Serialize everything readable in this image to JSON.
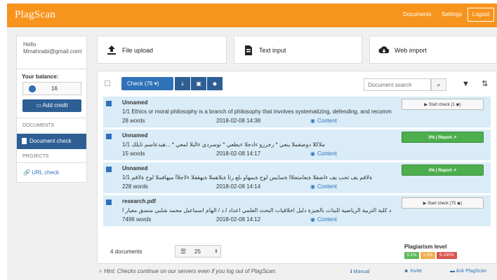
{
  "app": {
    "logo": "PlagScan"
  },
  "topnav": {
    "documents": "Documents",
    "settings": "Settings",
    "logout": "Logout"
  },
  "sidebar": {
    "greeting": "Hello Mmahnabi@gmail.com!",
    "balance_label": "Your balance:",
    "balance_value": "16",
    "add_credit": "Add credit",
    "section_documents": "DOCUMENTS",
    "document_check": "Document check",
    "section_projects": "PROJECTS",
    "url_check": "URL check"
  },
  "upload_options": [
    {
      "label": "File upload",
      "icon": "upload-icon"
    },
    {
      "label": "Text input",
      "icon": "text-input-icon"
    },
    {
      "label": "Web import",
      "icon": "cloud-download-icon"
    }
  ],
  "toolbar": {
    "check_label": "Check (76 ▾)",
    "search_placeholder": "Document search"
  },
  "documents": [
    {
      "title": "Unnamed",
      "preview": "1/1 Ethics or moral philosophy is a branch of philosophy that involves systematizing, defending, and recommen",
      "words": "28 words",
      "date": "2018-02-08 14:38",
      "content": "Content",
      "action": "▶ Start check (1 ◉)",
      "action_type": "start"
    },
    {
      "title": "Unnamed",
      "preview": "1/1 ملاكلا دوصقملا ينعي * رجرزو ءادجلا ءيطعي * نوسردي ءالبلا لمعي * ...هيدعاسم تايلك",
      "words": "15 words",
      "date": "2018-02-08 14:17",
      "content": "Content",
      "action": "0% | Report ↗",
      "action_type": "report"
    },
    {
      "title": "Unnamed",
      "preview": "1/1 ةلاقم يف ثحب يف ءاضقلا ةيعامتجلاا ةسايس لوح ةيمهأو ىلع رثأ ةيلاهملا ةيهقفلا ءلاجلأا ميهافملا لوح ةلاقم",
      "words": "228 words",
      "date": "2018-02-08 14:14",
      "content": "Content",
      "action": "0% | Report ↗",
      "action_type": "report"
    },
    {
      "title": "research.pdf",
      "preview": "ع التطوير المستمر والتأهيل لاعتماد كلية التربية الرياضية للبنات بالجيزة دليل اخلاقيات البحث العلمي اعداد ا.د / الهام اسماعيل محمد شلبي منسق معيار ا",
      "words": "7496 words",
      "date": "2018-02-08 14:12",
      "content": "Content",
      "action": "▶ Start check (75 ◉)",
      "action_type": "start"
    }
  ],
  "footer_bar": {
    "doc_count": "4 documents",
    "page_size": "25"
  },
  "plagiarism_level": {
    "title": "Plagiarism level",
    "levels": [
      {
        "label": "0-1%",
        "color": "#5cb85c"
      },
      {
        "label": "1-5%",
        "color": "#f0ad4e"
      },
      {
        "label": "5-100%",
        "color": "#d9534f"
      }
    ]
  },
  "footer": {
    "hint": "Hint: Checks continue on our servers even if you log out of PlagScan.",
    "manual": "Manual",
    "invite": "Invite",
    "ask": "Ask PlagScan"
  },
  "colors": {
    "brand": "#f7941d",
    "primary": "#2f72b8",
    "row_bg": "#d9ecf7",
    "success": "#4cae4c"
  }
}
